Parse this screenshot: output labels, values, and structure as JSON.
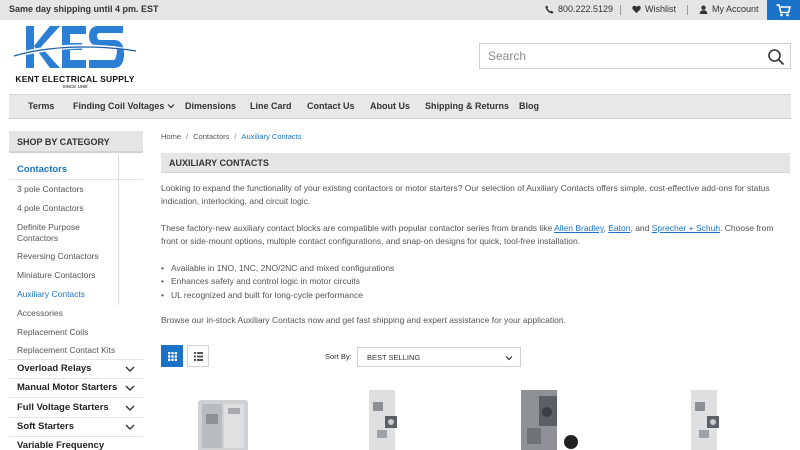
{
  "topbar": {
    "shipping": "Same day shipping until 4 pm. EST",
    "phone": "800.222.5129",
    "wishlist": "Wishlist",
    "account": "My Account",
    "phone_icon": "phone-icon",
    "heart_icon": "heart-icon",
    "user_icon": "user-icon",
    "cart_icon": "cart-icon"
  },
  "logo": {
    "letters": "KES",
    "brand": "KENT ELECTRICAL SUPPLY",
    "since": "SINCE 1989"
  },
  "search": {
    "placeholder": "Search"
  },
  "nav": {
    "items": [
      "Terms",
      "Finding Coil Voltages",
      "Dimensions",
      "Line Card",
      "Contact Us",
      "About Us",
      "Shipping & Returns",
      "Blog"
    ]
  },
  "sidebar": {
    "heading": "SHOP BY CATEGORY",
    "categories": [
      "Contactors",
      "3 pole Contactors",
      "4 pole Contactors",
      "Definite Purpose",
      "Contactors",
      "Reversing Contactors",
      "Miniature Contactors",
      "Auxiliary Contacts",
      "Accessories",
      "Replacement Coils",
      "Replacement Contact Kits",
      "Overload Relays",
      "Manual Motor Starters",
      "Full Voltage Starters",
      "Soft Starters",
      "Variable Frequency"
    ]
  },
  "breadcrumb": {
    "home": "Home",
    "sep": "/",
    "contactors": "Contactors",
    "current": "Auxiliary Contacts"
  },
  "page": {
    "title": "AUXILIARY CONTACTS",
    "intro": "Looking to expand the functionality of your existing contactors or motor starters? Our selection of Auxiliary Contacts offers simple, cost-effective add-ons for status indication, interlocking, and circuit logic.",
    "p2_a": "These factory-new auxiliary contact blocks are compatible with popular contactor series from brands like ",
    "link_ab": "Allen Bradley",
    "p2_b": ", ",
    "link_eaton": "Eaton",
    "p2_c": ", and ",
    "link_ss": "Sprecher + Schuh",
    "p2_d": ". Choose from front or side-mount options, multiple contact configurations, and snap-on designs for quick, tool-free installation.",
    "bullets": [
      "Available in 1NO, 1NC, 2NO/2NC and mixed configurations",
      "Enhances safety and control logic in motor circuits",
      "UL recognized and built for long-cycle performance"
    ],
    "closing": "Browse our in-stock Auxiliary Contacts now and get fast shipping and expert assistance for your application."
  },
  "toolbar": {
    "sort_label": "Sort By:",
    "sort_value": "BEST SELLING",
    "grid_icon": "grid-view-icon",
    "list_icon": "list-view-icon"
  },
  "colors": {
    "accent": "#1a73c8",
    "bar": "#e5e5e5",
    "text": "#545454"
  }
}
